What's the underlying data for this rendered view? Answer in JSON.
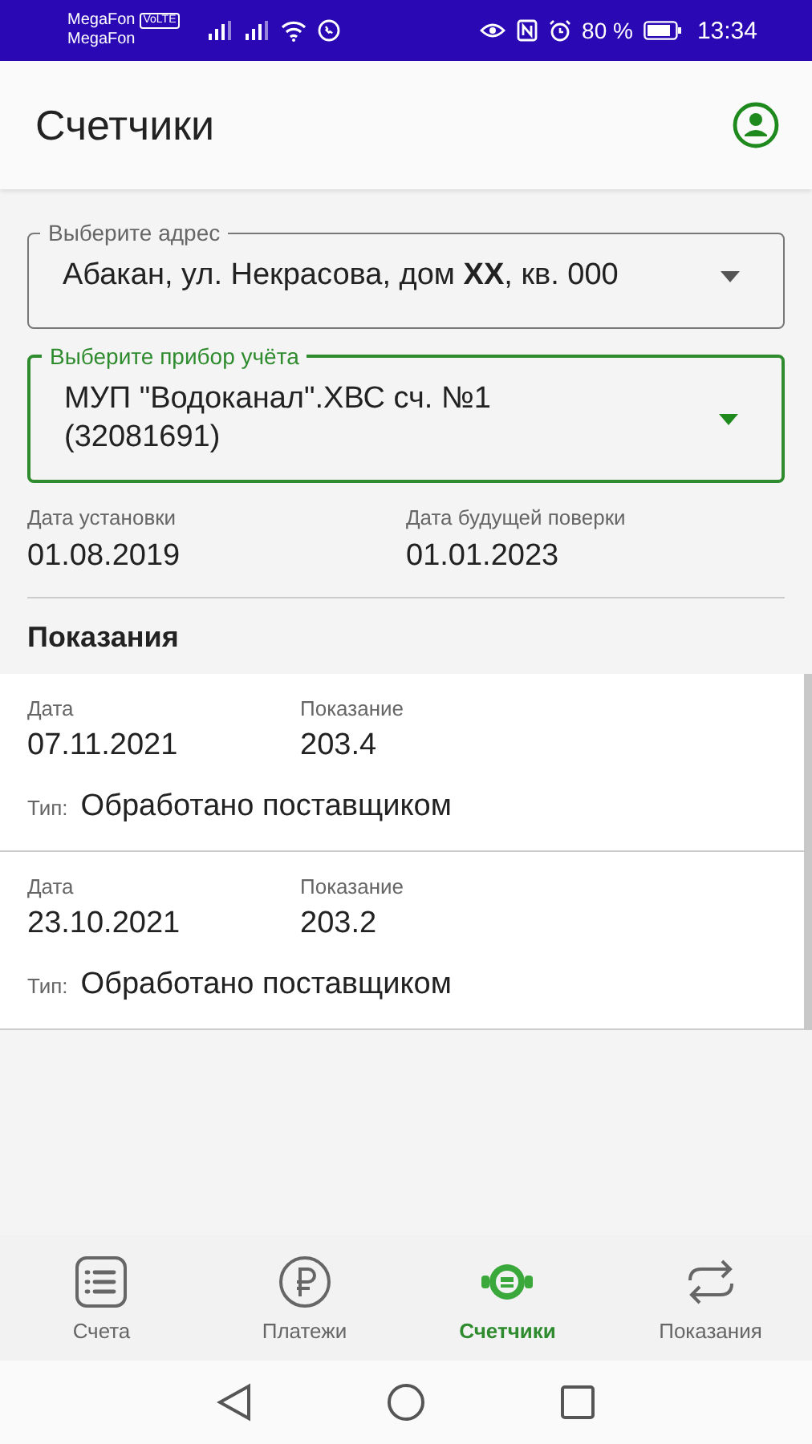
{
  "status_bar": {
    "carrier_1": "MegaFon",
    "volte": "VoLTE",
    "carrier_2": "MegaFon",
    "battery": "80 %",
    "time": "13:34"
  },
  "header": {
    "title": "Счетчики"
  },
  "selects": [
    {
      "label": "Выберите адрес",
      "value": "Абакан, ул. Некрасова, дом **XX**, кв. 000",
      "focused": false
    },
    {
      "label": "Выберите прибор учёта",
      "value": "МУП \"Водоканал\".ХВС сч. №1 (32081691)",
      "focused": true
    }
  ],
  "dates": [
    {
      "label": "Дата установки",
      "value": "01.08.2019"
    },
    {
      "label": "Дата будущей поверки",
      "value": "01.01.2023"
    }
  ],
  "readings": {
    "title": "Показания",
    "items": [
      {
        "date_label": "Дата",
        "date": "07.11.2021",
        "value_label": "Показание",
        "value": "203.4",
        "type_label": "Тип:",
        "type": "Обработано поставщиком"
      },
      {
        "date_label": "Дата",
        "date": "23.10.2021",
        "value_label": "Показание",
        "value": "203.2",
        "type_label": "Тип:",
        "type": "Обработано поставщиком"
      }
    ]
  },
  "bottom_nav": [
    {
      "label": "Счета",
      "kind": "list",
      "selected": false
    },
    {
      "label": "Платежи",
      "kind": "ruble",
      "selected": false
    },
    {
      "label": "Счетчики",
      "kind": "meter",
      "selected": true
    },
    {
      "label": "Показания",
      "kind": "exchange",
      "selected": false
    }
  ]
}
